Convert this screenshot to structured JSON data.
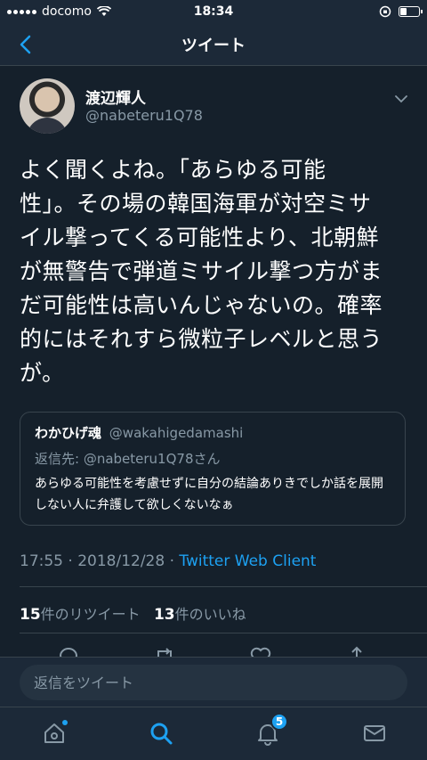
{
  "status_bar": {
    "carrier": "docomo",
    "time": "18:34"
  },
  "nav": {
    "title": "ツイート"
  },
  "tweet": {
    "display_name": "渡辺輝人",
    "handle": "@nabeteru1Q78",
    "text": "よく聞くよね。「あらゆる可能\n性」。その場の韓国海軍が対空ミサ\nイル撃ってくる可能性より、北朝鮮\nが無警告で弾道ミサイル撃つ方がま\nだ可能性は高いんじゃないの。確率\n的にはそれすら微粒子レベルと思う\nが。",
    "time": "17:55 · 2018/12/28 · ",
    "client": "Twitter Web Client",
    "retweet_count": "15",
    "retweet_label": "件のリツイート",
    "like_count": "13",
    "like_label": "件のいいね"
  },
  "quote": {
    "name": "わかひげ魂",
    "handle": "@wakahigedamashi",
    "reply_to": "返信先: @nabeteru1Q78さん",
    "text": "あらゆる可能性を考慮せずに自分の結論ありきでしか話を展開しない人に弁護して欲しくないなぁ"
  },
  "reply": {
    "placeholder": "返信をツイート"
  },
  "tabs": {
    "notifications_badge": "5"
  },
  "colors": {
    "background": "#15202b",
    "accent": "#1da1f2",
    "secondary_text": "#8899a6"
  }
}
